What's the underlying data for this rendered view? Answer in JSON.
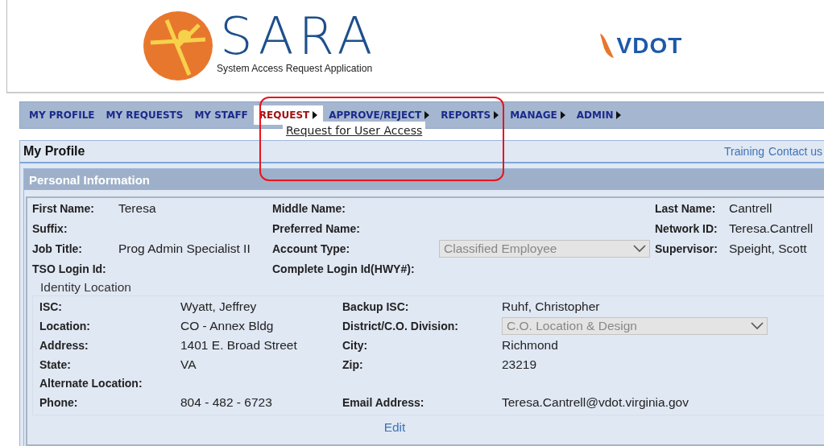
{
  "header": {
    "logo_title": "SARA",
    "logo_subtitle": "System Access Request Application",
    "brand": "VDOT"
  },
  "menu": [
    {
      "label": "MY PROFILE",
      "submenu": false,
      "selected": false
    },
    {
      "label": "MY REQUESTS",
      "submenu": false,
      "selected": false
    },
    {
      "label": "MY STAFF",
      "submenu": false,
      "selected": false
    },
    {
      "label": "REQUEST",
      "submenu": true,
      "selected": true
    },
    {
      "label": "APPROVE/REJECT",
      "submenu": true,
      "selected": false
    },
    {
      "label": "REPORTS",
      "submenu": true,
      "selected": false
    },
    {
      "label": "MANAGE",
      "submenu": true,
      "selected": false
    },
    {
      "label": "ADMIN",
      "submenu": true,
      "selected": false
    }
  ],
  "dropdown": {
    "items": [
      "Request for User Access"
    ]
  },
  "highlight": {
    "shown": true
  },
  "profile": {
    "title": "My Profile",
    "links": [
      "Training",
      "Contact us"
    ],
    "section_title": "Personal Information",
    "fields": [
      {
        "label": "First Name:",
        "value": "Teresa",
        "kind": "text"
      },
      {
        "label": "Middle Name:",
        "kind": "text"
      },
      {
        "label": "Last Name:",
        "value": "Cantrell",
        "kind": "text"
      },
      {
        "label": "Suffix:",
        "kind": "text"
      },
      {
        "label": "Preferred Name:",
        "kind": "text"
      },
      {
        "label": "Network ID:",
        "value": "Teresa.Cantrell",
        "kind": "text"
      },
      {
        "label": "Job Title:",
        "value": "Prog Admin Specialist II",
        "kind": "text"
      },
      {
        "label": "Account Type:",
        "value": "Classified Employee",
        "kind": "select",
        "disabled": true
      },
      {
        "label": "Supervisor:",
        "value": "Speight, Scott",
        "kind": "text"
      },
      {
        "label": "TSO Login Id:",
        "kind": "text"
      },
      {
        "label": "Complete Login Id(HWY#):",
        "kind": "text"
      }
    ],
    "identity": {
      "legend": "Identity Location",
      "fields": [
        {
          "label": "ISC:",
          "value": "Wyatt, Jeffrey",
          "kind": "text"
        },
        {
          "label": "Backup ISC:",
          "value": "Ruhf, Christopher",
          "kind": "text"
        },
        {
          "label": "Location:",
          "value": "CO - Annex Bldg",
          "kind": "text"
        },
        {
          "label": "District/C.O. Division:",
          "value": "C.O. Location & Design",
          "kind": "select",
          "disabled": true
        },
        {
          "label": "Address:",
          "value": "1401 E. Broad Street",
          "kind": "text"
        },
        {
          "label": "City:",
          "value": "Richmond",
          "kind": "text"
        },
        {
          "label": "State:",
          "value": "VA",
          "kind": "text"
        },
        {
          "label": "Zip:",
          "value": "23219",
          "kind": "text"
        },
        {
          "label": "Alternate Location:",
          "kind": "text"
        },
        {
          "kind": "blank"
        },
        {
          "label": "Phone:",
          "value": "804 - 482 - 6723",
          "kind": "text"
        },
        {
          "label": "Email Address:",
          "value": "Teresa.Cantrell@vdot.virginia.gov",
          "kind": "text"
        }
      ]
    },
    "edit_link": "Edit"
  }
}
